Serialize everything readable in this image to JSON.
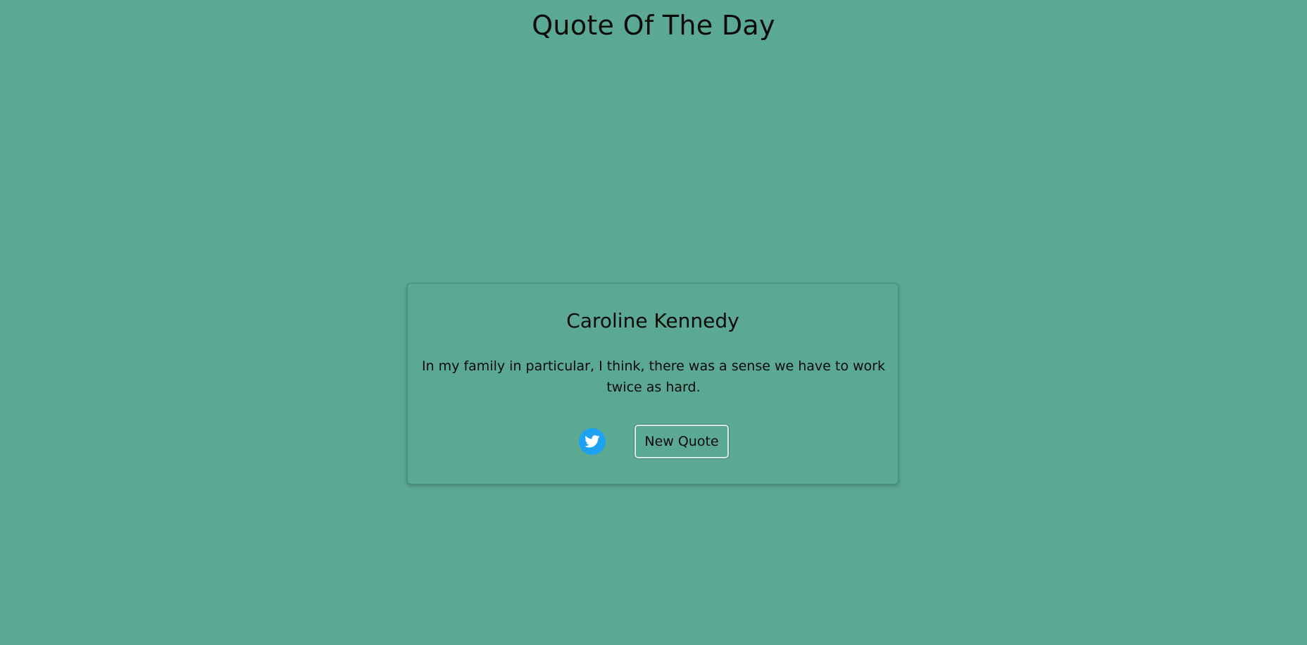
{
  "page": {
    "title": "Quote Of The Day"
  },
  "quote": {
    "author": "Caroline Kennedy",
    "text": "In my family in particular, I think, there was a sense we have to work twice as hard."
  },
  "actions": {
    "tweet_icon": "twitter-bird-icon",
    "new_quote_label": "New Quote"
  },
  "colors": {
    "background": "#5ba993",
    "twitter": "#1da1f2"
  }
}
